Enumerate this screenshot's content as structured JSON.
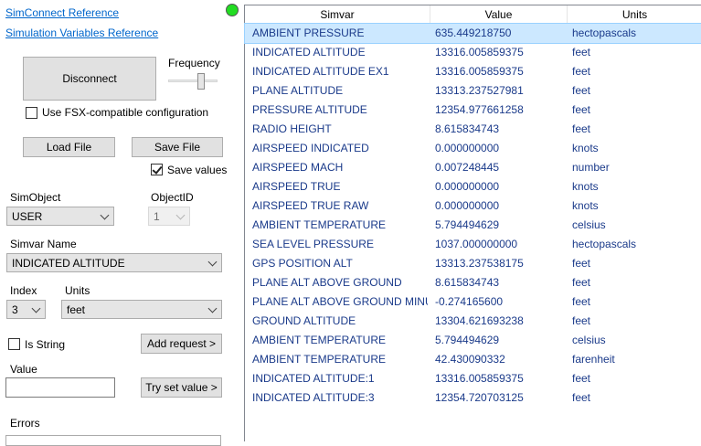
{
  "links": {
    "simconnect_ref": "SimConnect Reference",
    "simvars_ref": "Simulation Variables Reference"
  },
  "status_color": "#22dd22",
  "connection": {
    "disconnect_label": "Disconnect",
    "frequency_label": "Frequency",
    "fsx_label": "Use FSX-compatible configuration",
    "fsx_checked": false
  },
  "file": {
    "load_label": "Load File",
    "save_label": "Save File",
    "save_values_label": "Save values",
    "save_values_checked": true
  },
  "request": {
    "simobject_label": "SimObject",
    "simobject_value": "USER",
    "objectid_label": "ObjectID",
    "objectid_value": "1",
    "simvar_name_label": "Simvar Name",
    "simvar_name_value": "INDICATED ALTITUDE",
    "index_label": "Index",
    "index_value": "3",
    "units_label": "Units",
    "units_value": "feet",
    "is_string_label": "Is String",
    "is_string_checked": false,
    "add_request_label": "Add request >",
    "value_label": "Value",
    "value_input": "",
    "try_set_label": "Try set value >",
    "errors_label": "Errors"
  },
  "grid": {
    "columns": [
      "Simvar",
      "Value",
      "Units"
    ],
    "rows": [
      {
        "simvar": "AMBIENT PRESSURE",
        "value": "635.449218750",
        "units": "hectopascals"
      },
      {
        "simvar": "INDICATED ALTITUDE",
        "value": "13316.005859375",
        "units": "feet"
      },
      {
        "simvar": "INDICATED ALTITUDE EX1",
        "value": "13316.005859375",
        "units": "feet"
      },
      {
        "simvar": "PLANE ALTITUDE",
        "value": "13313.237527981",
        "units": "feet"
      },
      {
        "simvar": "PRESSURE ALTITUDE",
        "value": "12354.977661258",
        "units": "feet"
      },
      {
        "simvar": "RADIO HEIGHT",
        "value": "8.615834743",
        "units": "feet"
      },
      {
        "simvar": "AIRSPEED INDICATED",
        "value": "0.000000000",
        "units": "knots"
      },
      {
        "simvar": "AIRSPEED MACH",
        "value": "0.007248445",
        "units": "number"
      },
      {
        "simvar": "AIRSPEED TRUE",
        "value": "0.000000000",
        "units": "knots"
      },
      {
        "simvar": "AIRSPEED TRUE RAW",
        "value": "0.000000000",
        "units": "knots"
      },
      {
        "simvar": "AMBIENT TEMPERATURE",
        "value": "5.794494629",
        "units": "celsius"
      },
      {
        "simvar": "SEA LEVEL PRESSURE",
        "value": "1037.000000000",
        "units": "hectopascals"
      },
      {
        "simvar": "GPS POSITION ALT",
        "value": "13313.237538175",
        "units": "feet"
      },
      {
        "simvar": "PLANE ALT ABOVE GROUND",
        "value": "8.615834743",
        "units": "feet"
      },
      {
        "simvar": "PLANE ALT ABOVE GROUND MINUS",
        "value": "-0.274165600",
        "units": "feet"
      },
      {
        "simvar": "GROUND ALTITUDE",
        "value": "13304.621693238",
        "units": "feet"
      },
      {
        "simvar": "AMBIENT TEMPERATURE",
        "value": "5.794494629",
        "units": "celsius"
      },
      {
        "simvar": "AMBIENT TEMPERATURE",
        "value": "42.430090332",
        "units": "farenheit"
      },
      {
        "simvar": "INDICATED ALTITUDE:1",
        "value": "13316.005859375",
        "units": "feet"
      },
      {
        "simvar": "INDICATED ALTITUDE:3",
        "value": "12354.720703125",
        "units": "feet"
      }
    ]
  }
}
